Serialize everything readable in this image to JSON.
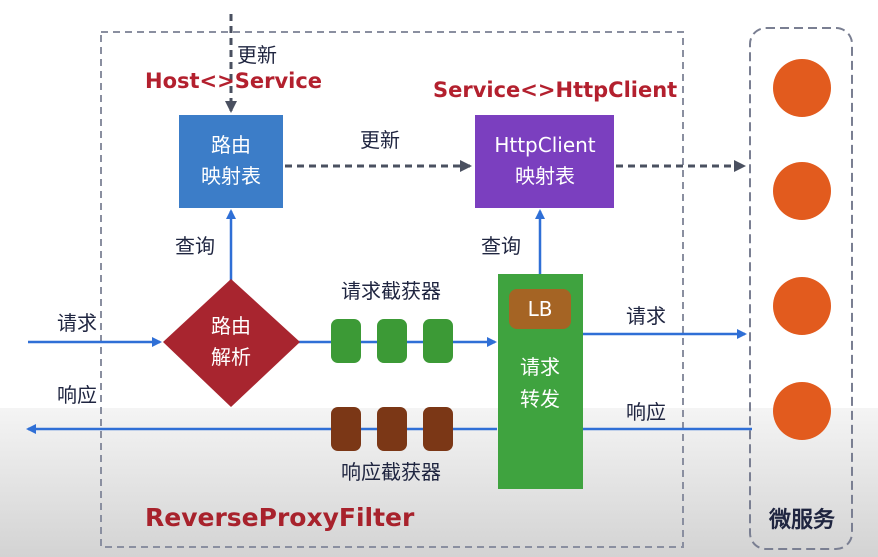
{
  "title": "ReverseProxyFilter",
  "microservices": {
    "label": "微服务",
    "count": 4,
    "color": "#e25b1e"
  },
  "route_table": {
    "label_line1": "路由",
    "label_line2": "映射表",
    "color": "#3c7dc8"
  },
  "httpclient_table": {
    "label_line1": "HttpClient",
    "label_line2": "映射表",
    "color": "#7b3fbf"
  },
  "route_parse": {
    "label_line1": "路由",
    "label_line2": "解析",
    "color": "#a8252f"
  },
  "forward": {
    "label_line1": "请求",
    "label_line2": "转发",
    "color": "#3fa33f",
    "lb_label": "LB",
    "lb_color": "#a56424"
  },
  "interceptors": {
    "request_label": "请求截获器",
    "request_color": "#3c9a36",
    "response_label": "响应截获器",
    "response_color": "#7b3716"
  },
  "labels": {
    "update_top": "更新",
    "host_service": "Host<>Service",
    "service_httpclient": "Service<>HttpClient",
    "update_middle": "更新",
    "query_left": "查询",
    "query_right": "查询",
    "request_in": "请求",
    "response_out": "响应",
    "request_to_ms": "请求",
    "response_from_ms": "响应"
  },
  "colors": {
    "arrow_blue": "#2f6fd6",
    "dashed_gray": "#4a5060",
    "frame_gray": "#8a8fa0"
  }
}
